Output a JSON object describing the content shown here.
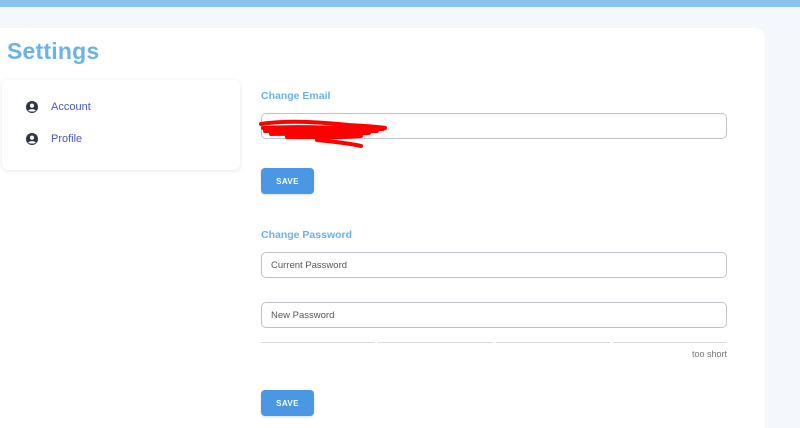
{
  "page": {
    "title": "Settings"
  },
  "sidebar": {
    "items": [
      {
        "label": "Account",
        "icon": "user-circle-icon"
      },
      {
        "label": "Profile",
        "icon": "user-circle-icon"
      }
    ]
  },
  "email_section": {
    "title": "Change Email",
    "email_value": "",
    "save_label": "SAVE"
  },
  "password_section": {
    "title": "Change Password",
    "current_placeholder": "Current Password",
    "new_placeholder": "New Password",
    "strength_label": "too short",
    "save_label": "SAVE"
  },
  "colors": {
    "accent": "#6ab2e8",
    "button": "#4a97e3",
    "link": "#4a54c9",
    "redaction": "#ff0000"
  }
}
